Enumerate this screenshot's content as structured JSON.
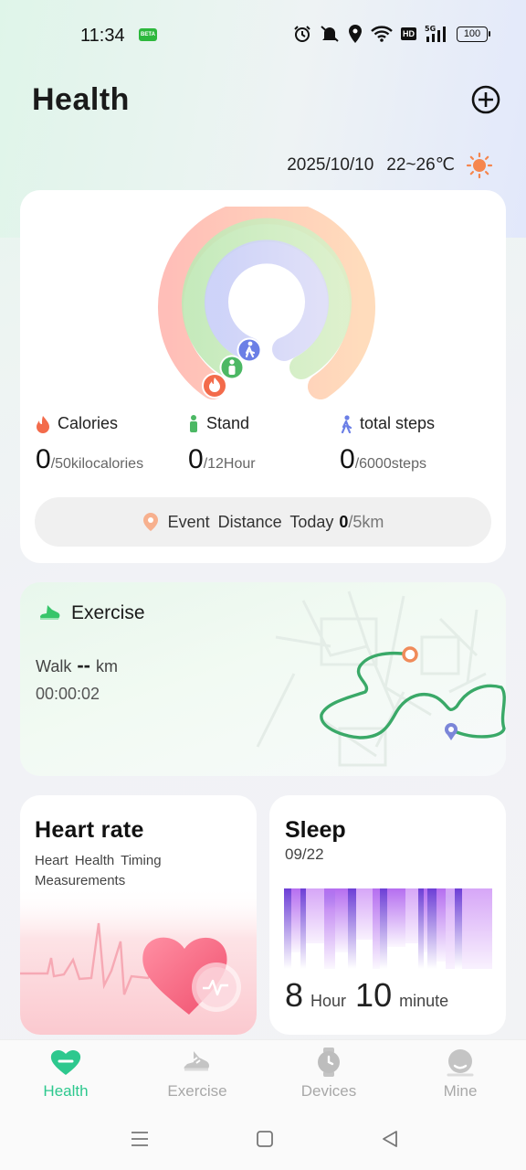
{
  "status": {
    "time": "11:34",
    "beta_badge": "BETA",
    "battery": "100",
    "hd": "HD",
    "signal": "5G"
  },
  "header": {
    "title": "Health"
  },
  "weather": {
    "date": "2025/10/10",
    "temperature": "22~26℃"
  },
  "rings": {
    "calories": {
      "label": "Calories",
      "value": "0",
      "target": "/50kilocalories"
    },
    "stand": {
      "label": "Stand",
      "value": "0",
      "target": "/12Hour"
    },
    "steps": {
      "label": "total  steps",
      "value": "0",
      "target": "/6000steps"
    }
  },
  "distance": {
    "label": "Event  Distance  Today",
    "value": "0",
    "target": "/5km"
  },
  "exercise": {
    "title": "Exercise",
    "walk_label": "Walk",
    "walk_value": "--",
    "walk_unit": "km",
    "duration": "00:00:02"
  },
  "heart_rate": {
    "title": "Heart rate",
    "subtitle": "Heart  Health  Timing  Measurements"
  },
  "sleep": {
    "title": "Sleep",
    "date": "09/22",
    "hours": "8",
    "hour_unit": "Hour",
    "minutes": "10",
    "minute_unit": "minute"
  },
  "tabs": [
    {
      "label": "Health",
      "active": true
    },
    {
      "label": "Exercise",
      "active": false
    },
    {
      "label": "Devices",
      "active": false
    },
    {
      "label": "Mine",
      "active": false
    }
  ],
  "colors": {
    "accent": "#2dc88e",
    "calories": "#f36b4b",
    "stand": "#4cb864",
    "steps": "#6b7fe6",
    "route": "#3aa968"
  }
}
